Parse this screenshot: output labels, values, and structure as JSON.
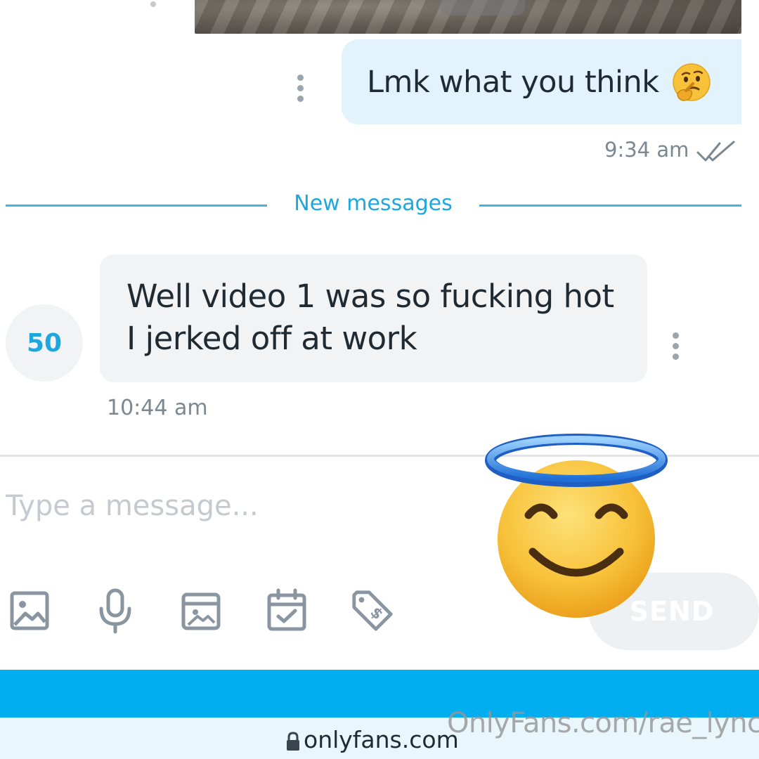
{
  "conversation": {
    "outgoing": {
      "text": "Lmk what you think",
      "emoji": "thinking-face",
      "time": "9:34 am",
      "status": "read"
    },
    "divider_label": "New messages",
    "incoming": {
      "avatar_label": "50",
      "line1": "Well video 1 was so fucking hot",
      "line2": "I jerked off at work",
      "time": "10:44 am"
    }
  },
  "composer": {
    "placeholder": "Type a message...",
    "tools": [
      "image-icon",
      "microphone-icon",
      "vault-icon",
      "schedule-icon",
      "price-tag-icon"
    ],
    "send_label": "SEND"
  },
  "overlay": {
    "emoji": "smiling-face-with-halo"
  },
  "browser": {
    "url": "onlyfans.com"
  },
  "watermark": "OnlyFans.com/rae_lynch",
  "colors": {
    "accent": "#00aef0",
    "outgoing_bubble": "#e3f3fb",
    "incoming_bubble": "#f1f3f4",
    "muted_text": "#7b8791"
  }
}
